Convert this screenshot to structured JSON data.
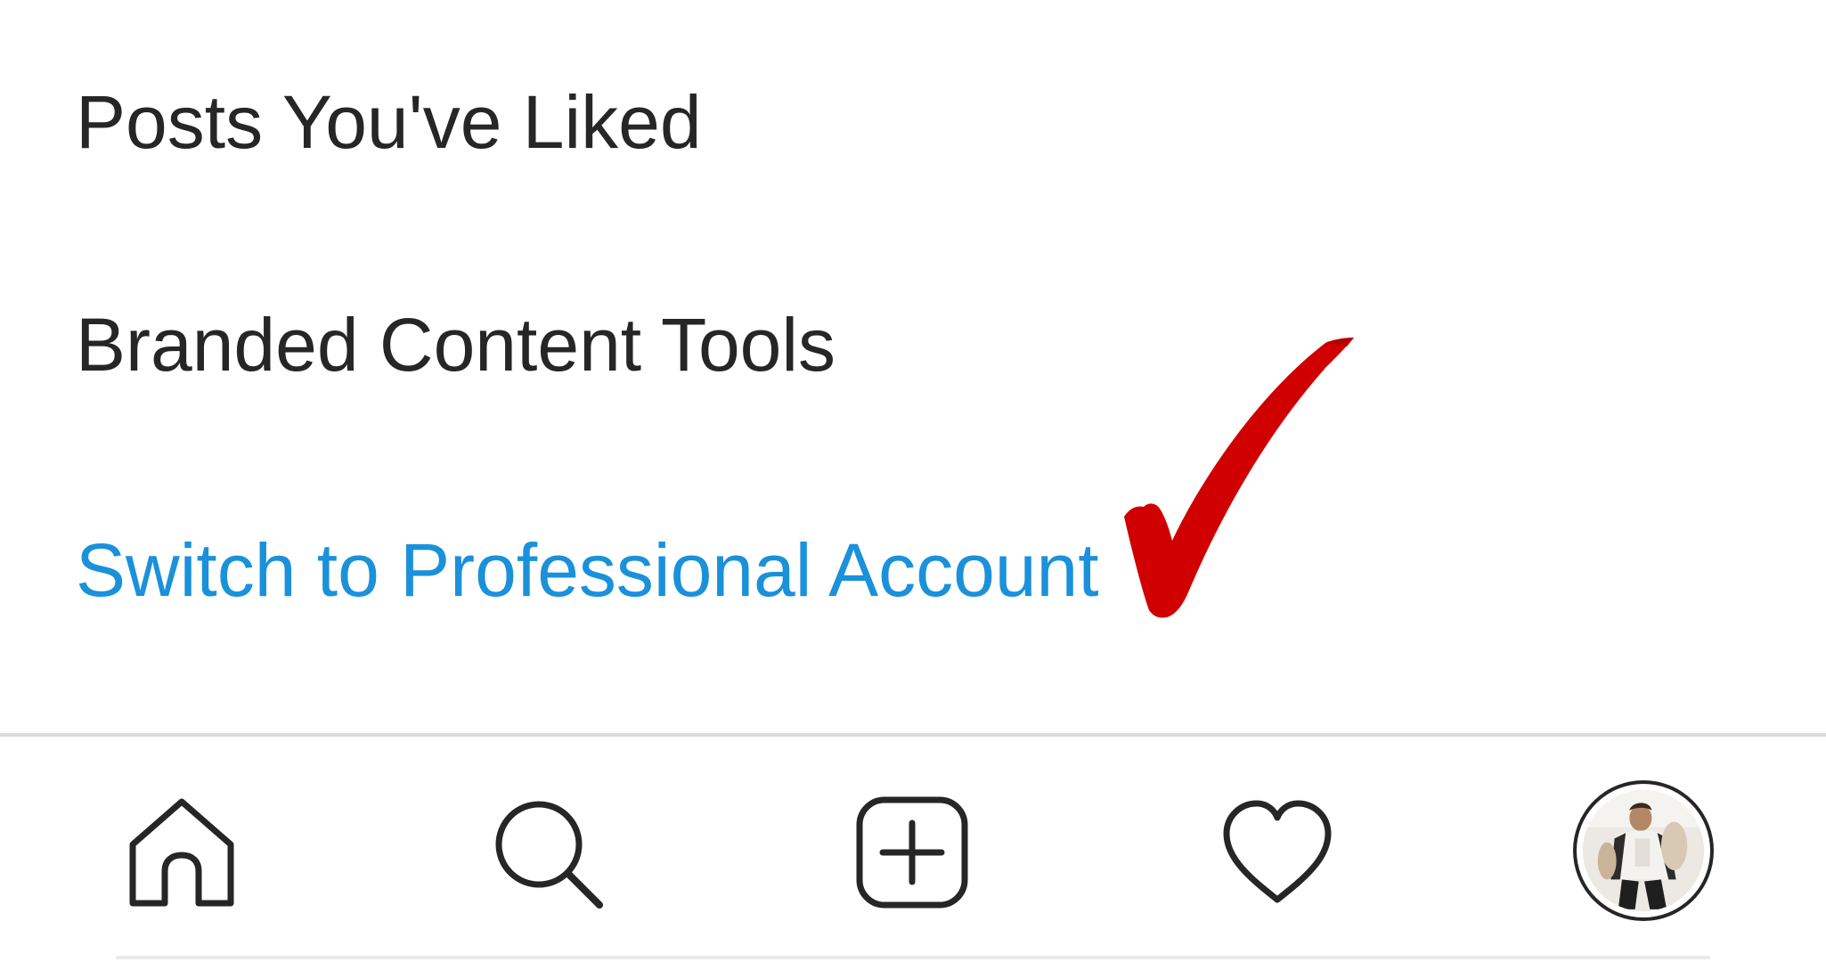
{
  "menu": {
    "items": [
      {
        "label": "Posts You've Liked"
      },
      {
        "label": "Branded Content Tools"
      },
      {
        "label": "Switch to Professional Account",
        "color": "#1a91da"
      }
    ]
  },
  "annotation": {
    "icon": "checkmark-icon",
    "color": "#d10000"
  },
  "tab_bar": {
    "tabs": [
      {
        "icon": "home-icon"
      },
      {
        "icon": "search-icon"
      },
      {
        "icon": "plus-square-icon"
      },
      {
        "icon": "heart-icon"
      },
      {
        "icon": "profile-avatar"
      }
    ]
  },
  "colors": {
    "text": "#262626",
    "link": "#1a91da",
    "divider": "#dbdbdb",
    "background": "#ffffff"
  }
}
